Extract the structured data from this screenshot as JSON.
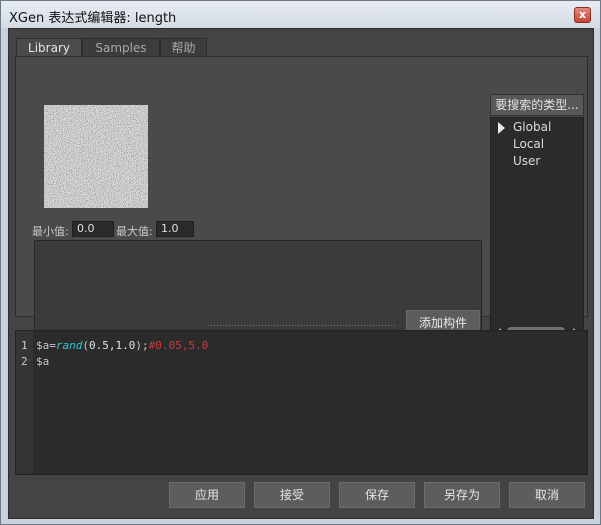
{
  "window": {
    "title": "XGen 表达式编辑器: length",
    "close_glyph": "x"
  },
  "tabs": [
    {
      "label": "Library",
      "active": true
    },
    {
      "label": "Samples",
      "active": false
    },
    {
      "label": "帮助",
      "active": false
    }
  ],
  "library": {
    "min_label": "最小值:",
    "min_value": "0.0",
    "max_label": "最大值:",
    "max_value": "1.0",
    "add_widget_label": "添加构件",
    "search_type_label": "要搜索的类型...",
    "scope_items": [
      "Global",
      "Local",
      "User"
    ],
    "selected_scope": "Global"
  },
  "editor": {
    "lines": [
      {
        "num": "1",
        "var": "$a=",
        "fn": "rand",
        "args_open": "(",
        "args": "0.5,1.0",
        "args_close": ");",
        "comment": "#0.05,5.0"
      },
      {
        "num": "2",
        "var": "$a",
        "fn": "",
        "args_open": "",
        "args": "",
        "args_close": "",
        "comment": ""
      }
    ]
  },
  "buttons": {
    "apply": "应用",
    "accept": "接受",
    "save": "保存",
    "save_as": "另存为",
    "cancel": "取消"
  },
  "colors": {
    "panel_bg": "#444444",
    "code_bg": "#2b2b2b",
    "function_color": "#31c6d0",
    "comment_color": "#c83a3f"
  }
}
